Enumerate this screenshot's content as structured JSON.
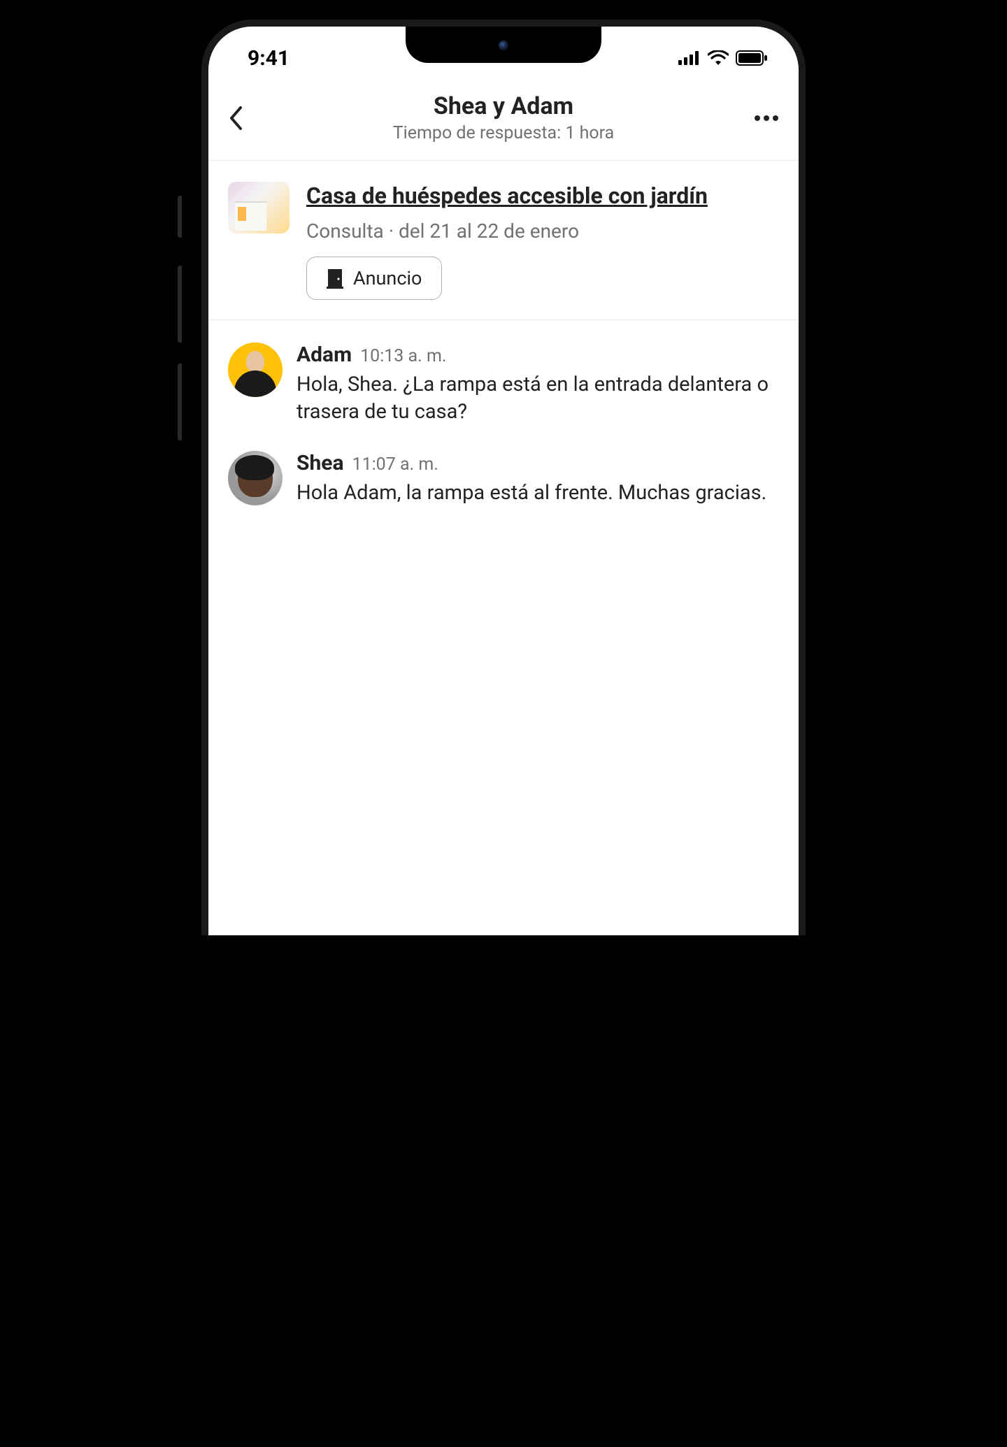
{
  "statusBar": {
    "time": "9:41"
  },
  "header": {
    "title": "Shea y Adam",
    "subtitle": "Tiempo de respuesta: 1 hora"
  },
  "listing": {
    "title": "Casa de huéspedes accesible con jardín",
    "meta": "Consulta · del 21 al 22 de enero",
    "buttonLabel": "Anuncio"
  },
  "messages": [
    {
      "sender": "Adam",
      "time": "10:13 a. m.",
      "text": "Hola, Shea. ¿La rampa está en la entrada delantera o trasera de tu casa?"
    },
    {
      "sender": "Shea",
      "time": "11:07 a. m.",
      "text": "Hola Adam, la rampa está al frente. Muchas gracias."
    }
  ]
}
